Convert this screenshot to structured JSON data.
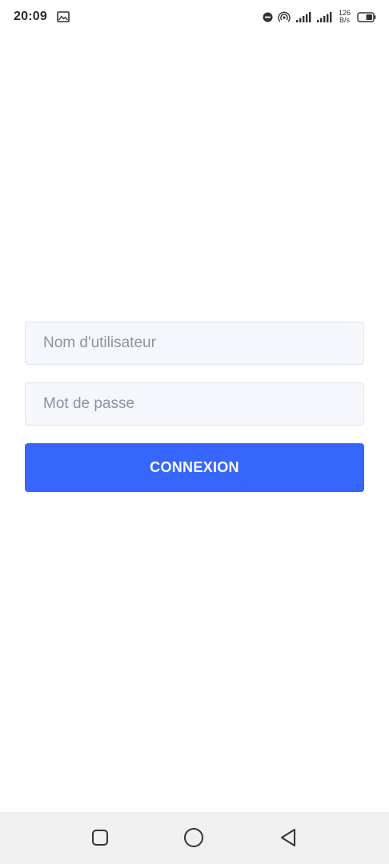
{
  "status_bar": {
    "time": "20:09",
    "net_speed_value": "126",
    "net_speed_unit": "B/s",
    "icons": [
      "gallery-icon",
      "do-not-disturb-icon",
      "hotspot-icon",
      "signal-icon",
      "signal-icon",
      "battery-icon"
    ]
  },
  "login": {
    "username_placeholder": "Nom d'utilisateur",
    "username_value": "",
    "password_placeholder": "Mot de passe",
    "password_value": "",
    "submit_label": "CONNEXION"
  },
  "colors": {
    "primary": "#3766fd",
    "input_bg": "#f5f7fc",
    "input_border": "#e2e6ee",
    "placeholder": "#8b93a3",
    "nav_bg": "#f0f0f0"
  },
  "nav_bar": {
    "buttons": [
      "recents-icon",
      "home-icon",
      "back-icon"
    ]
  }
}
